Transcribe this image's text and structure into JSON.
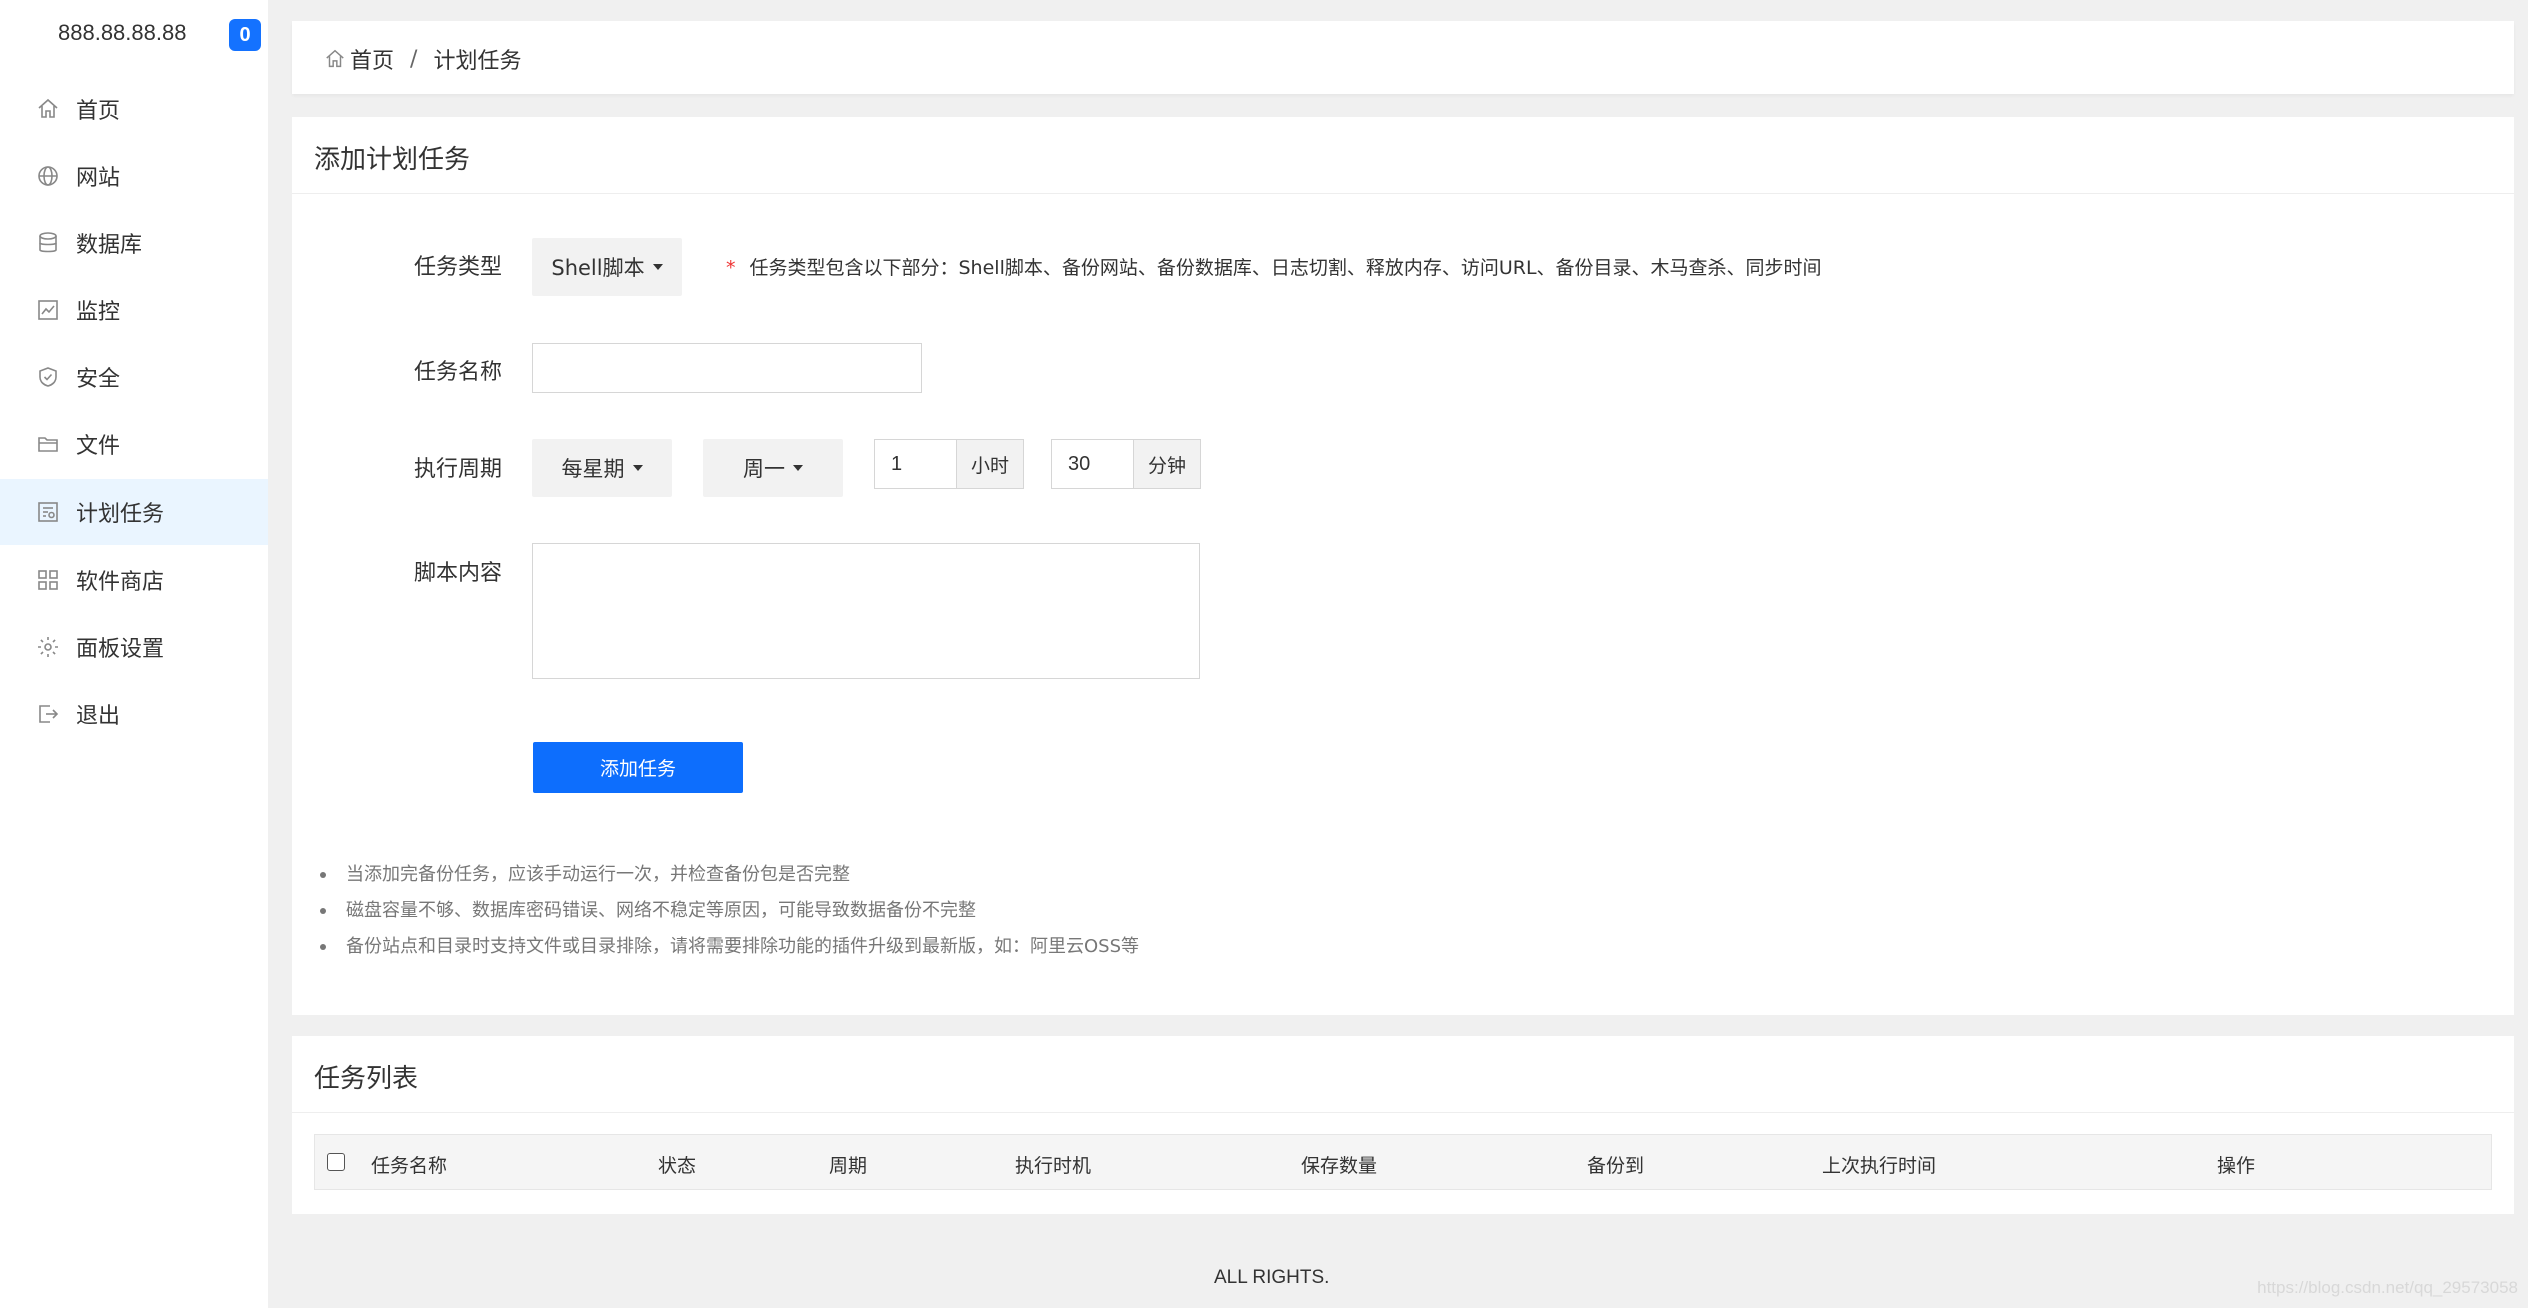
{
  "sidebar": {
    "ip": "888.88.88.88",
    "badge": "0",
    "items": [
      {
        "label": "首页",
        "icon": "home-icon"
      },
      {
        "label": "网站",
        "icon": "globe-icon"
      },
      {
        "label": "数据库",
        "icon": "database-icon"
      },
      {
        "label": "监控",
        "icon": "monitor-icon"
      },
      {
        "label": "安全",
        "icon": "shield-icon"
      },
      {
        "label": "文件",
        "icon": "folder-icon"
      },
      {
        "label": "计划任务",
        "icon": "calendar-icon"
      },
      {
        "label": "软件商店",
        "icon": "grid-icon"
      },
      {
        "label": "面板设置",
        "icon": "gear-icon"
      },
      {
        "label": "退出",
        "icon": "logout-icon"
      }
    ],
    "active_index": 6
  },
  "breadcrumb": {
    "home": "首页",
    "separator": "/",
    "current": "计划任务"
  },
  "form": {
    "title": "添加计划任务",
    "task_type_label": "任务类型",
    "task_type_value": "Shell脚本",
    "task_type_hint": "任务类型包含以下部分：Shell脚本、备份网站、备份数据库、日志切割、释放内存、访问URL、备份目录、木马查杀、同步时间",
    "task_name_label": "任务名称",
    "task_name_value": "",
    "period_label": "执行周期",
    "period_value": "每星期",
    "weekday_value": "周一",
    "hour_value": "1",
    "hour_unit": "小时",
    "minute_value": "30",
    "minute_unit": "分钟",
    "script_label": "脚本内容",
    "script_value": "",
    "submit_label": "添加任务",
    "notes": [
      "当添加完备份任务，应该手动运行一次，并检查备份包是否完整",
      "磁盘容量不够、数据库密码错误、网络不稳定等原因，可能导致数据备份不完整",
      "备份站点和目录时支持文件或目录排除，请将需要排除功能的插件升级到最新版，如：阿里云OSS等"
    ]
  },
  "task_list": {
    "title": "任务列表",
    "columns": [
      "任务名称",
      "状态",
      "周期",
      "执行时机",
      "保存数量",
      "备份到",
      "上次执行时间",
      "操作"
    ]
  },
  "footer": {
    "text": "ALL RIGHTS.",
    "watermark": "https://blog.csdn.net/qq_29573058"
  },
  "colors": {
    "accent": "#0d6efd",
    "badge": "#1472ff",
    "active_bg": "#eaf5ff",
    "page_bg": "#f0f0f0"
  }
}
